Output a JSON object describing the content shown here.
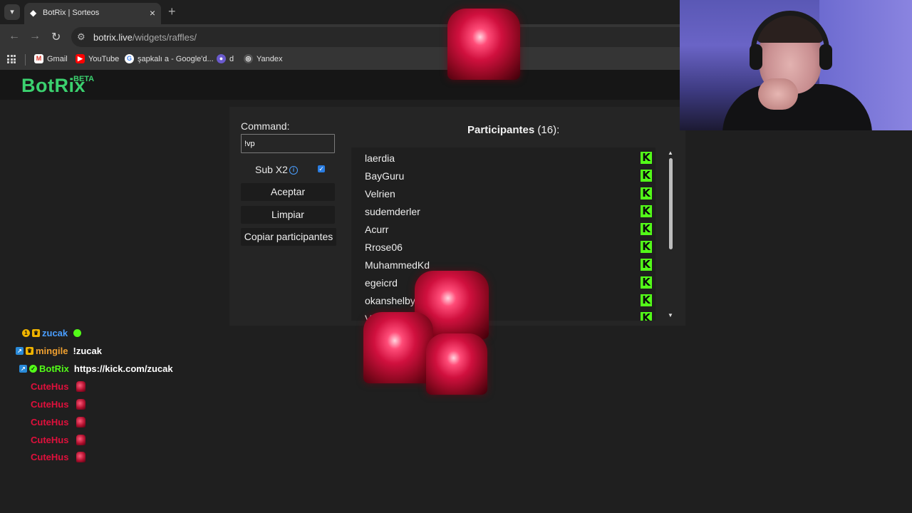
{
  "browser": {
    "tab_title": "BotRix | Sorteos",
    "url_host": "botrix.live",
    "url_path": "/widgets/raffles/",
    "bookmarks": [
      {
        "label": "Gmail",
        "icon": "gmail-icon"
      },
      {
        "label": "YouTube",
        "icon": "youtube-icon"
      },
      {
        "label": "şapkalı a - Google'd...",
        "icon": "google-icon"
      },
      {
        "label": "d",
        "icon": "bookmark-icon"
      },
      {
        "label": "Yandex",
        "icon": "yandex-icon"
      }
    ]
  },
  "header": {
    "logo": "BotRix",
    "badge": "BETA"
  },
  "raffle": {
    "command_label": "Command:",
    "command_value": "!vp",
    "sub_label": "Sub X2",
    "sub_checked": true,
    "accept_button": "Aceptar",
    "clear_button": "Limpiar",
    "copy_button": "Copiar participantes",
    "participants_title": "Participantes",
    "participants_count": "(16):",
    "participants": [
      "laerdia",
      "BayGuru",
      "Velrien",
      "sudemderler",
      "Acurr",
      "Rrose06",
      "MuhammedKd",
      "egeicrd",
      "okanshelby",
      "Vayronid"
    ]
  },
  "chat": [
    {
      "user": "zucak",
      "message": "",
      "user_color": "#4a9eff"
    },
    {
      "user": "mingile",
      "message": "!zucak",
      "user_color": "#f0a030"
    },
    {
      "user": "BotRix",
      "message": "https://kick.com/zucak",
      "user_color": "#53fc18"
    },
    {
      "user": "CuteHus",
      "message": "",
      "user_color": "#e0103c"
    },
    {
      "user": "CuteHus",
      "message": "",
      "user_color": "#e0103c"
    },
    {
      "user": "CuteHus",
      "message": "",
      "user_color": "#e0103c"
    },
    {
      "user": "CuteHus",
      "message": "",
      "user_color": "#e0103c"
    },
    {
      "user": "CuteHus",
      "message": "",
      "user_color": "#e0103c"
    }
  ],
  "colors": {
    "brand_green": "#3bd16f",
    "kick_green": "#53fc18",
    "background": "#1f1f1f"
  }
}
